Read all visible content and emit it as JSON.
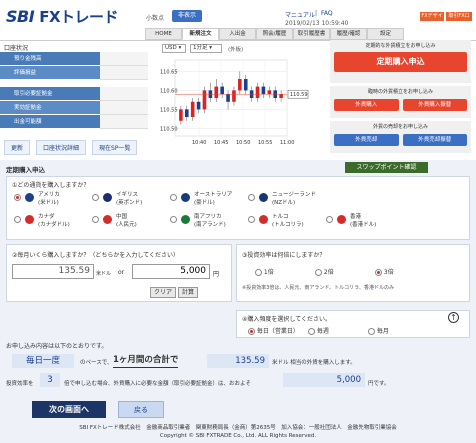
{
  "logo": {
    "brand": "SBI",
    "name": "FXトレード"
  },
  "top": {
    "decimal_label": "小数点",
    "decimal_value": "非表示",
    "manual": "マニュアル",
    "faq": "FAQ",
    "datetime": "2019/02/13  10:59:40",
    "btn_fxdesign": "FXデザイン",
    "btn_logout": "取引FXログアウト"
  },
  "tabs": [
    "HOME",
    "新規注文",
    "入出金",
    "照会/履歴",
    "取引履歴書",
    "履歴/確認",
    "設定"
  ],
  "sidebar": {
    "title": "口座状況",
    "rows": [
      "預り金残高",
      "評価損益",
      "取引必要証拠金",
      "実効証拠金",
      "出金可能額"
    ],
    "buttons": [
      "更新",
      "口座状況詳細",
      "現在SP一覧"
    ]
  },
  "chart": {
    "pair": "USD",
    "interval": "1分足",
    "mode": "(外板)",
    "price_tag": "110.59",
    "y_ticks": [
      "110.65",
      "110.60",
      "110.55",
      "110.50"
    ],
    "x_ticks": [
      "10:40",
      "10:45",
      "10:50",
      "10:55",
      "11:00"
    ]
  },
  "chart_data": {
    "type": "candlestick",
    "y_range": [
      110.48,
      110.68
    ],
    "candles": [
      {
        "o": 110.52,
        "c": 110.55,
        "h": 110.56,
        "l": 110.51
      },
      {
        "o": 110.55,
        "c": 110.53,
        "h": 110.56,
        "l": 110.52
      },
      {
        "o": 110.53,
        "c": 110.57,
        "h": 110.58,
        "l": 110.52
      },
      {
        "o": 110.57,
        "c": 110.55,
        "h": 110.58,
        "l": 110.54
      },
      {
        "o": 110.55,
        "c": 110.6,
        "h": 110.61,
        "l": 110.54
      },
      {
        "o": 110.6,
        "c": 110.58,
        "h": 110.62,
        "l": 110.57
      },
      {
        "o": 110.58,
        "c": 110.61,
        "h": 110.63,
        "l": 110.57
      },
      {
        "o": 110.61,
        "c": 110.59,
        "h": 110.62,
        "l": 110.58
      },
      {
        "o": 110.59,
        "c": 110.57,
        "h": 110.6,
        "l": 110.55
      },
      {
        "o": 110.57,
        "c": 110.6,
        "h": 110.61,
        "l": 110.56
      },
      {
        "o": 110.6,
        "c": 110.63,
        "h": 110.65,
        "l": 110.59
      },
      {
        "o": 110.63,
        "c": 110.6,
        "h": 110.64,
        "l": 110.59
      },
      {
        "o": 110.6,
        "c": 110.58,
        "h": 110.61,
        "l": 110.57
      },
      {
        "o": 110.58,
        "c": 110.61,
        "h": 110.62,
        "l": 110.57
      },
      {
        "o": 110.61,
        "c": 110.59,
        "h": 110.62,
        "l": 110.58
      },
      {
        "o": 110.59,
        "c": 110.6,
        "h": 110.61,
        "l": 110.58
      },
      {
        "o": 110.6,
        "c": 110.58,
        "h": 110.61,
        "l": 110.57
      },
      {
        "o": 110.58,
        "c": 110.59,
        "h": 110.6,
        "l": 110.57
      }
    ]
  },
  "right": {
    "box1_caption": "定期的な外貨積立をお申し込み",
    "box1_button": "定期購入申込",
    "box2_caption": "臨時の外貨積立をお申し込み",
    "box2_btn_a": "外貨購入",
    "box2_btn_b": "外貨購入振替",
    "box3_caption": "外貨の売却をお申し込み",
    "box3_btn_a": "外貨売却",
    "box3_btn_b": "外貨売却振替"
  },
  "form": {
    "title": "定期購入申込",
    "swap_button": "スワップポイント確認",
    "q1": "①どの通貨を購入しますか？",
    "currencies": [
      {
        "name": "アメリカ",
        "sub": "(米ドル)",
        "color": "#1e3f8a",
        "selected": true
      },
      {
        "name": "イギリス",
        "sub": "(英ポンド)",
        "color": "#1d2f6b",
        "selected": false
      },
      {
        "name": "オーストラリア",
        "sub": "(豪ドル)",
        "color": "#1b3a7a",
        "selected": false
      },
      {
        "name": "ニュージーランド",
        "sub": "(NZドル)",
        "color": "#1b3570",
        "selected": false
      },
      {
        "name": "カナダ",
        "sub": "(カナダドル)",
        "color": "#d62b2b",
        "selected": false
      },
      {
        "name": "中国",
        "sub": "(人民元)",
        "color": "#d62b2b",
        "selected": false
      },
      {
        "name": "南アフリカ",
        "sub": "(南アランド)",
        "color": "#1a7a3a",
        "selected": false
      },
      {
        "name": "トルコ",
        "sub": "(トルコリラ)",
        "color": "#d62b2b",
        "selected": false
      },
      {
        "name": "香港",
        "sub": "(香港ドル)",
        "color": "#d62b2b",
        "selected": false
      }
    ],
    "q2": "②毎月いくら購入しますか？（どちらかを入力してください）",
    "amount_usd": "135.59",
    "amount_usd_unit": "米ドル",
    "or": "or",
    "amount_jpy": "5,000",
    "amount_jpy_unit": "円",
    "clear": "クリア",
    "calc": "計算",
    "q3": "③投資効率は何倍にしますか？",
    "leverage": [
      {
        "label": "1倍",
        "selected": false
      },
      {
        "label": "2倍",
        "selected": false
      },
      {
        "label": "3倍",
        "selected": true
      }
    ],
    "leverage_note": "※投資効率3倍は、人民元、南アランド、トルコリラ、香港ドルのみ",
    "q4": "④購入頻度を選択してください。",
    "frequency": [
      {
        "label": "毎日（営業日）",
        "selected": true
      },
      {
        "label": "毎週",
        "selected": false
      },
      {
        "label": "毎月",
        "selected": false
      }
    ],
    "summary_title": "お申し込み内容は以下のとおりです。",
    "freq_display": "毎日一度",
    "s_text1": "のペースで、",
    "period": "1ヶ月間の合計で",
    "s_usd": "135.59",
    "s_text2": "米ドル 相当の外貨を購入します。",
    "eff_label": "投資効率を",
    "eff_value": "3",
    "eff_text": "倍で申し込む場合、外貨購入に必要な金額（取引必要証拠金）は、おおよそ",
    "req_amount": "5,000",
    "req_unit": "円です。",
    "next": "次の画面へ",
    "back": "戻る"
  },
  "footer": {
    "line1": "SBI FXトレード株式会社　金融商品取引業者　関東財務局長（金商）第2635号　加入協会：一般社団法人　金融先物取引業協会",
    "line2": "Copyright © SBI FXTRADE Co., Ltd. ALL Rights Reserved."
  }
}
